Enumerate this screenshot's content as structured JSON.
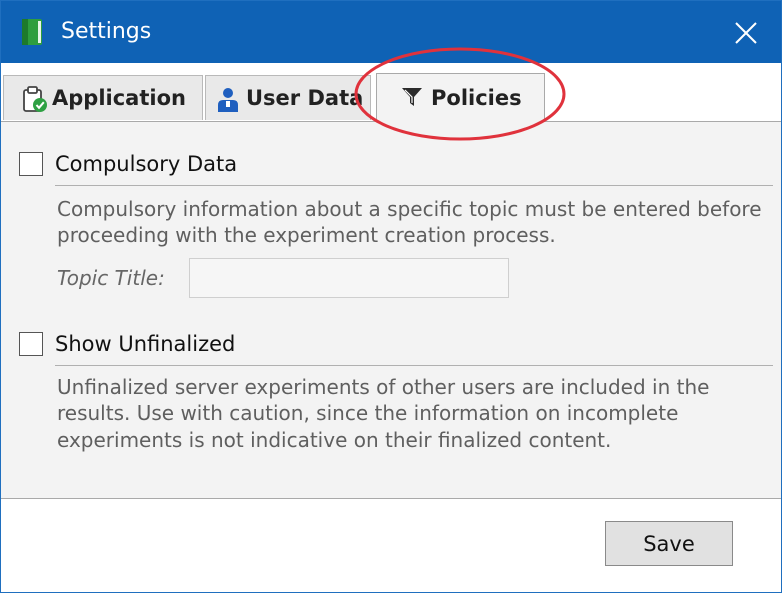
{
  "window": {
    "title": "Settings"
  },
  "tabs": [
    {
      "label": "Application",
      "icon": "clipboard-check-icon"
    },
    {
      "label": "User Data",
      "icon": "user-icon"
    },
    {
      "label": "Policies",
      "icon": "filter-icon",
      "selected": true
    }
  ],
  "policies": {
    "compulsory": {
      "label": "Compulsory Data",
      "checked": false,
      "description": "Compulsory information about a specific topic must be entered before proceeding with the experiment creation process.",
      "topic_label": "Topic Title:",
      "topic_value": ""
    },
    "unfinalized": {
      "label": "Show Unfinalized",
      "checked": false,
      "description": "Unfinalized server experiments of other users are included in the results. Use with caution, since the information on incomplete experiments is not indicative on their finalized content."
    }
  },
  "footer": {
    "save_label": "Save"
  },
  "colors": {
    "titlebar": "#0f62b5",
    "content_bg": "#f3f3f3",
    "annotation": "#e0323c"
  }
}
